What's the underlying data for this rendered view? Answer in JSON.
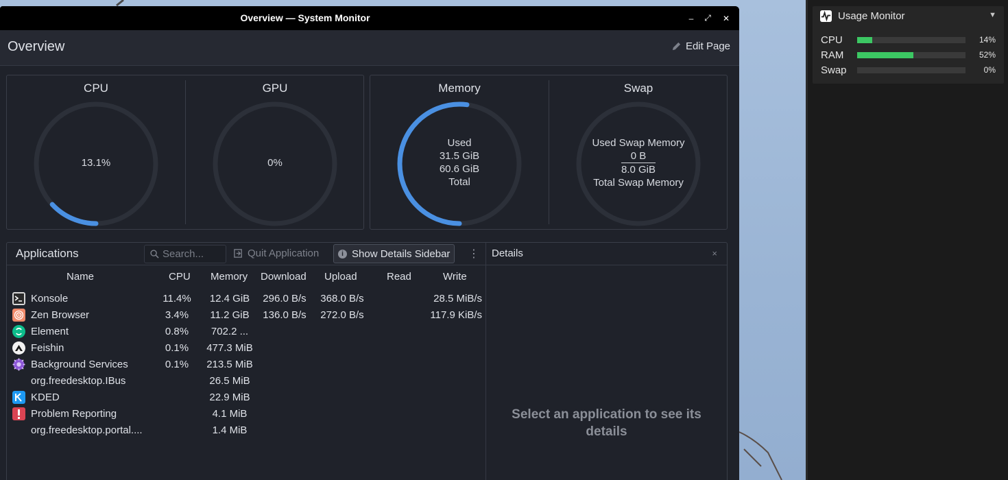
{
  "window": {
    "title": "Overview — System Monitor",
    "minimize": "–",
    "maximize": "⤢",
    "close": "✕"
  },
  "page": {
    "title": "Overview",
    "edit_label": "Edit Page"
  },
  "gauges": {
    "cpu": {
      "title": "CPU",
      "value": "13.1%",
      "fraction": 0.131
    },
    "gpu": {
      "title": "GPU",
      "value": "0%",
      "fraction": 0
    },
    "memory": {
      "title": "Memory",
      "used_label": "Used",
      "used": "31.5 GiB",
      "total": "60.6 GiB",
      "total_label": "Total",
      "fraction": 0.52
    },
    "swap": {
      "title": "Swap",
      "used_label": "Used Swap Memory",
      "used": "0 B",
      "total": "8.0 GiB",
      "total_label": "Total Swap Memory",
      "fraction": 0
    }
  },
  "applications": {
    "title": "Applications",
    "search_placeholder": "Search...",
    "quit_label": "Quit Application",
    "details_label": "Show Details Sidebar",
    "more_icon": "⋮",
    "columns": [
      "Name",
      "CPU",
      "Memory",
      "Download",
      "Upload",
      "Read",
      "Write"
    ],
    "rows": [
      {
        "icon": "konsole-icon",
        "name": "Konsole",
        "cpu": "11.4%",
        "memory": "12.4 GiB",
        "download": "296.0 B/s",
        "upload": "368.0 B/s",
        "read": "",
        "write": "28.5 MiB/s"
      },
      {
        "icon": "zen-browser-icon",
        "name": "Zen Browser",
        "cpu": "3.4%",
        "memory": "11.2 GiB",
        "download": "136.0 B/s",
        "upload": "272.0 B/s",
        "read": "",
        "write": "117.9 KiB/s"
      },
      {
        "icon": "element-icon",
        "name": "Element",
        "cpu": "0.8%",
        "memory": "702.2 ...",
        "download": "",
        "upload": "",
        "read": "",
        "write": ""
      },
      {
        "icon": "feishin-icon",
        "name": "Feishin",
        "cpu": "0.1%",
        "memory": "477.3 MiB",
        "download": "",
        "upload": "",
        "read": "",
        "write": ""
      },
      {
        "icon": "background-services-icon",
        "name": "Background Services",
        "cpu": "0.1%",
        "memory": "213.5 MiB",
        "download": "",
        "upload": "",
        "read": "",
        "write": ""
      },
      {
        "icon": "",
        "name": "org.freedesktop.IBus",
        "cpu": "",
        "memory": "26.5 MiB",
        "download": "",
        "upload": "",
        "read": "",
        "write": ""
      },
      {
        "icon": "kded-icon",
        "name": "KDED",
        "cpu": "",
        "memory": "22.9 MiB",
        "download": "",
        "upload": "",
        "read": "",
        "write": ""
      },
      {
        "icon": "problem-reporting-icon",
        "name": "Problem Reporting",
        "cpu": "",
        "memory": "4.1 MiB",
        "download": "",
        "upload": "",
        "read": "",
        "write": ""
      },
      {
        "icon": "",
        "name": "org.freedesktop.portal....",
        "cpu": "",
        "memory": "1.4 MiB",
        "download": "",
        "upload": "",
        "read": "",
        "write": ""
      }
    ]
  },
  "details": {
    "title": "Details",
    "close": "×",
    "empty_message": "Select an application to see its details"
  },
  "usage_monitor": {
    "title": "Usage Monitor",
    "dropdown": "▼",
    "bars": [
      {
        "label": "CPU",
        "value": "14%",
        "fraction": 0.14
      },
      {
        "label": "RAM",
        "value": "52%",
        "fraction": 0.52
      },
      {
        "label": "Swap",
        "value": "0%",
        "fraction": 0
      }
    ]
  },
  "colors": {
    "accent": "#4a90e2",
    "usage_bar": "#3cc763",
    "window_bg": "#1f222a"
  }
}
